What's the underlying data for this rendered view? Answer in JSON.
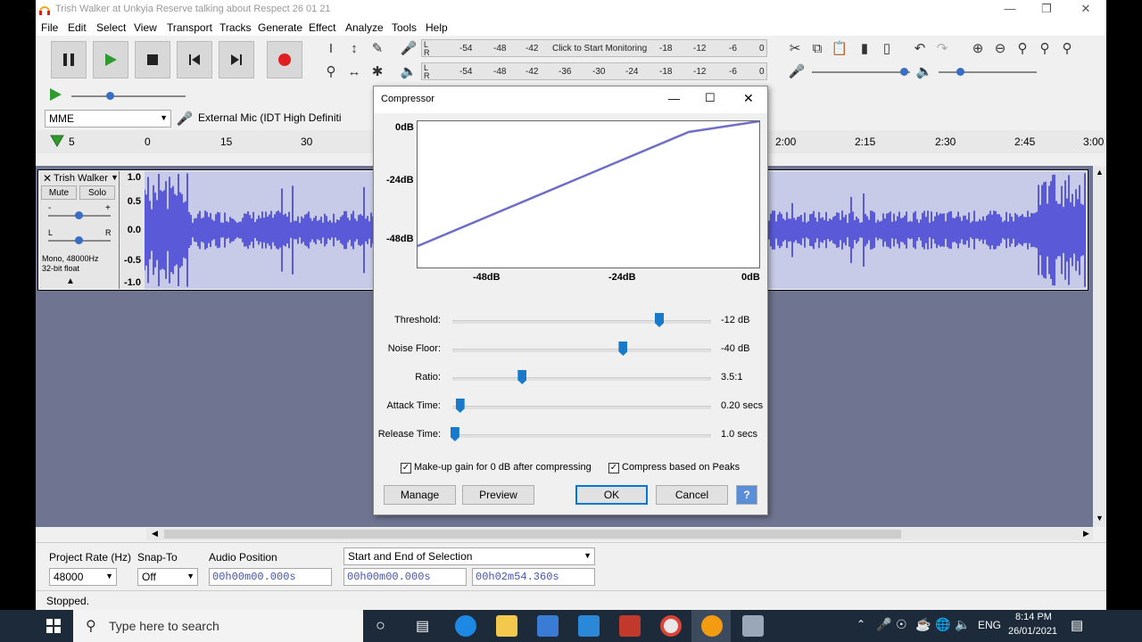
{
  "window": {
    "title": "Trish Walker at Unkyia Reserve talking about Respect 26 01 21"
  },
  "menu": [
    "File",
    "Edit",
    "Select",
    "View",
    "Transport",
    "Tracks",
    "Generate",
    "Effect",
    "Analyze",
    "Tools",
    "Help"
  ],
  "meters": {
    "record_ticks": [
      "-54",
      "-48",
      "-42",
      "Click to Start Monitoring",
      "-18",
      "-12",
      "-6",
      "0"
    ],
    "play_ticks": [
      "-54",
      "-48",
      "-42",
      "-36",
      "-30",
      "-24",
      "-18",
      "-12",
      "-6",
      "0"
    ],
    "rec_label_l": "L",
    "rec_label_r": "R",
    "play_label_l": "L",
    "play_label_r": "R"
  },
  "device": {
    "host": "MME",
    "mic": "External Mic (IDT High Definiti"
  },
  "ruler": {
    "left_value": "5",
    "ticks": [
      "0",
      "15",
      "30",
      "2:00",
      "2:15",
      "2:30",
      "2:45",
      "3:00"
    ]
  },
  "track": {
    "name": "Trish Walker",
    "mute": "Mute",
    "solo": "Solo",
    "pan_l": "L",
    "pan_r": "R",
    "gain_minus": "-",
    "gain_plus": "+",
    "info1": "Mono, 48000Hz",
    "info2": "32-bit float",
    "scale": [
      "1.0",
      "0.5",
      "0.0",
      "-0.5",
      "-1.0"
    ]
  },
  "dialog": {
    "title": "Compressor",
    "graph": {
      "y_labels": [
        "0dB",
        "-24dB",
        "-48dB"
      ],
      "x_labels": [
        "-48dB",
        "-24dB",
        "0dB"
      ]
    },
    "params": [
      {
        "label": "Threshold:",
        "value": "-12 dB",
        "fraction": 0.8
      },
      {
        "label": "Noise Floor:",
        "value": "-40 dB",
        "fraction": 0.66
      },
      {
        "label": "Ratio:",
        "value": "3.5:1",
        "fraction": 0.27
      },
      {
        "label": "Attack Time:",
        "value": "0.20 secs",
        "fraction": 0.03
      },
      {
        "label": "Release Time:",
        "value": "1.0 secs",
        "fraction": 0.01
      }
    ],
    "makeup_gain": "Make-up gain for 0 dB after compressing",
    "peaks": "Compress based on Peaks",
    "manage": "Manage",
    "preview": "Preview",
    "ok": "OK",
    "cancel": "Cancel",
    "help": "?"
  },
  "selection": {
    "project_rate_label": "Project Rate (Hz)",
    "project_rate": "48000",
    "snap_label": "Snap-To",
    "snap": "Off",
    "audio_pos_label": "Audio Position",
    "audio_pos": "00h00m00.000s",
    "sel_mode": "Start and End of Selection",
    "sel_start": "00h00m00.000s",
    "sel_end": "00h02m54.360s"
  },
  "status": "Stopped.",
  "taskbar": {
    "search": "Type here to search",
    "lang": "ENG",
    "time": "8:14 PM",
    "date": "26/01/2021"
  }
}
